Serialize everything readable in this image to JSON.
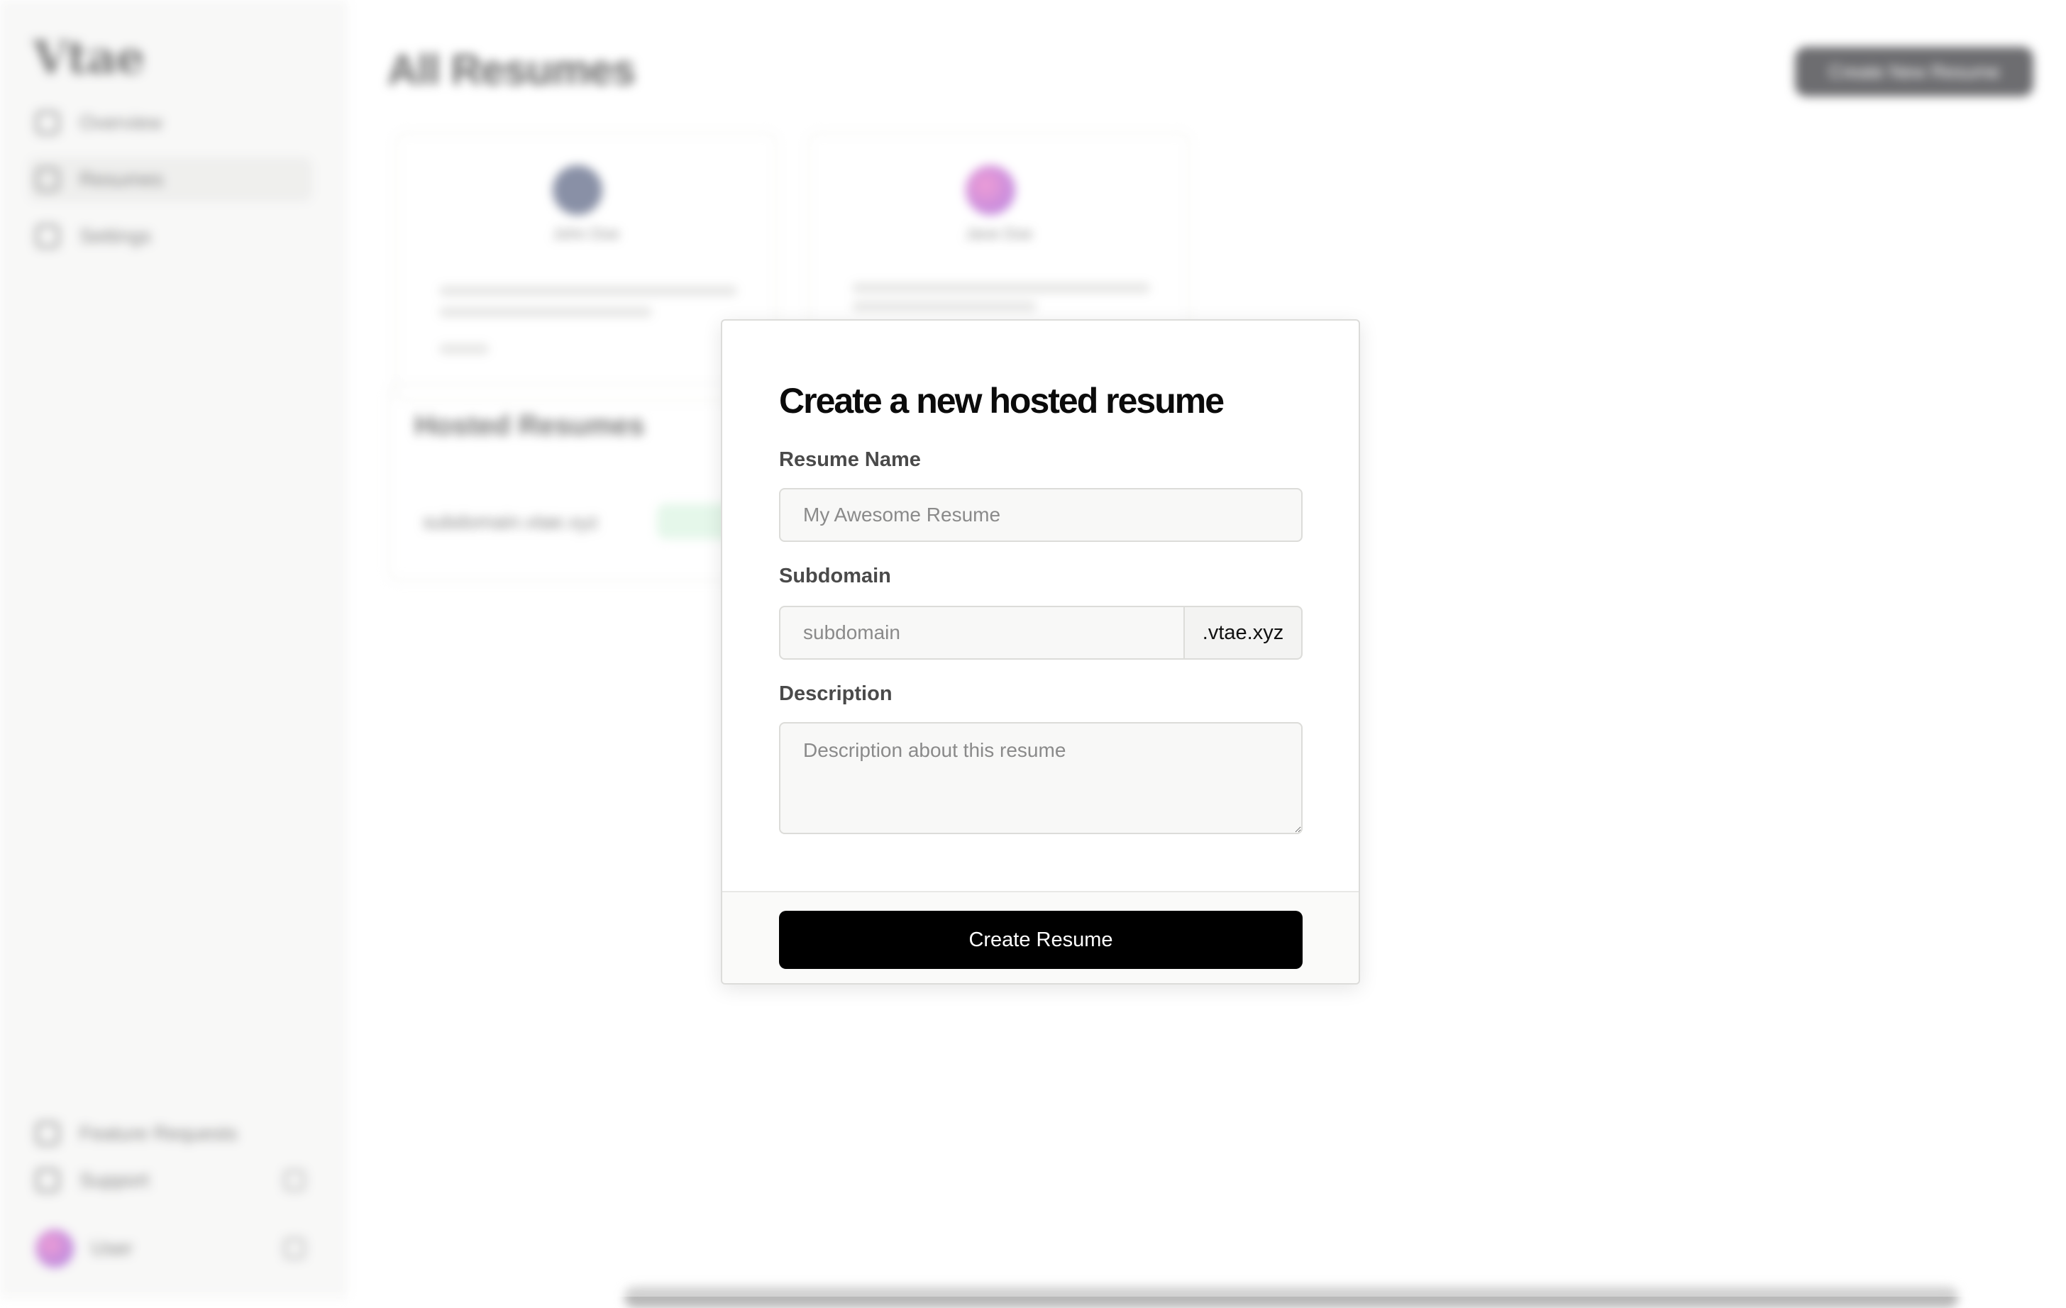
{
  "app": {
    "logo": "Vtae",
    "nav": [
      {
        "label": "Overview",
        "icon": "home-icon"
      },
      {
        "label": "Resumes",
        "icon": "document-icon"
      },
      {
        "label": "Settings",
        "icon": "gear-icon"
      }
    ],
    "bottom": [
      {
        "label": "Feature Requests",
        "icon": "lightbulb-icon"
      },
      {
        "label": "Support",
        "icon": "phone-icon"
      }
    ],
    "user": {
      "name": "User"
    },
    "main_title": "All Resumes",
    "primary_button": "Create New Resume",
    "section_title": "Hosted Resumes",
    "cards": [
      {
        "name": "John Doe"
      },
      {
        "name": "Jane Doe"
      }
    ],
    "row": {
      "text": "subdomain.vtae.xyz"
    }
  },
  "modal": {
    "title": "Create a new hosted resume",
    "resume_name": {
      "label": "Resume Name",
      "placeholder": "My Awesome Resume",
      "value": ""
    },
    "subdomain": {
      "label": "Subdomain",
      "placeholder": "subdomain",
      "suffix": ".vtae.xyz",
      "value": ""
    },
    "description": {
      "label": "Description",
      "placeholder": "Description about this resume",
      "value": ""
    },
    "submit_label": "Create Resume"
  }
}
